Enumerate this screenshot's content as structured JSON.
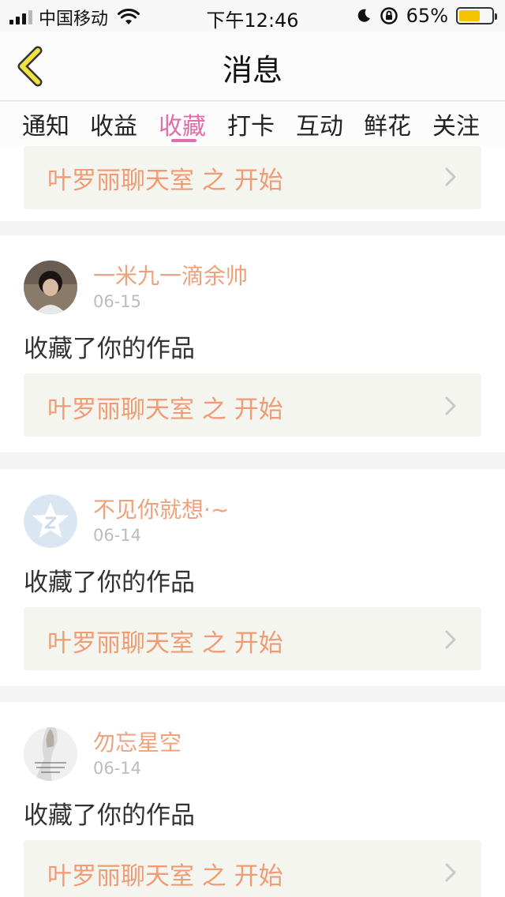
{
  "status_bar": {
    "carrier": "中国移动",
    "time": "下午12:46",
    "battery_percent_label": "65%",
    "battery_level": 0.65
  },
  "nav": {
    "title": "消息"
  },
  "tabs": [
    {
      "label": "通知",
      "active": false
    },
    {
      "label": "收益",
      "active": false
    },
    {
      "label": "收藏",
      "active": true
    },
    {
      "label": "打卡",
      "active": false
    },
    {
      "label": "互动",
      "active": false
    },
    {
      "label": "鲜花",
      "active": false
    },
    {
      "label": "关注",
      "active": false
    }
  ],
  "partial_item": {
    "work_title": "叶罗丽聊天室 之 开始"
  },
  "items": [
    {
      "username": "一米九一滴余帅",
      "date": "06-15",
      "action": "收藏了你的作品",
      "work_title": "叶罗丽聊天室 之 开始"
    },
    {
      "username": "不见你就想·~",
      "date": "06-14",
      "action": "收藏了你的作品",
      "work_title": "叶罗丽聊天室 之 开始"
    },
    {
      "username": "勿忘星空",
      "date": "06-14",
      "action": "收藏了你的作品",
      "work_title": "叶罗丽聊天室 之 开始"
    }
  ],
  "colors": {
    "accent_pink": "#df6fa8",
    "username_orange": "#eea27c",
    "link_orange": "#ef9c74",
    "back_arrow_yellow": "#f1e33d"
  }
}
